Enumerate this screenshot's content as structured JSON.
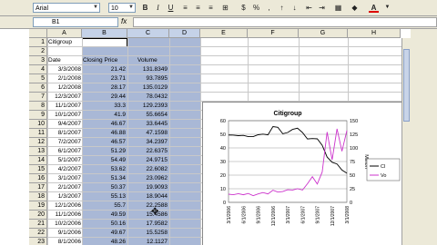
{
  "toolbar": {
    "font_name": "Arial",
    "font_size": "10",
    "bold_label": "B",
    "italic_label": "I",
    "underline_label": "U",
    "font_color_label": "A"
  },
  "formula_bar": {
    "name_box": "B1",
    "fx_label": "fx",
    "content": ""
  },
  "sheet": {
    "columns": [
      "A",
      "B",
      "C",
      "D",
      "E",
      "F",
      "G",
      "H"
    ],
    "rows": [
      {
        "n": "1",
        "a": "Citigroup",
        "b": "",
        "c": ""
      },
      {
        "n": "2",
        "a": "",
        "b": "",
        "c": ""
      },
      {
        "n": "3",
        "a": "Date",
        "b": "Closing Price",
        "c": "Volume"
      },
      {
        "n": "4",
        "a": "3/3/2008",
        "b": "21.42",
        "c": "131.8349"
      },
      {
        "n": "5",
        "a": "2/1/2008",
        "b": "23.71",
        "c": "93.7895"
      },
      {
        "n": "6",
        "a": "1/2/2008",
        "b": "28.17",
        "c": "135.0129"
      },
      {
        "n": "7",
        "a": "12/3/2007",
        "b": "29.44",
        "c": "78.0432"
      },
      {
        "n": "8",
        "a": "11/1/2007",
        "b": "33.3",
        "c": "129.2393"
      },
      {
        "n": "9",
        "a": "10/1/2007",
        "b": "41.9",
        "c": "55.6654"
      },
      {
        "n": "10",
        "a": "9/4/2007",
        "b": "46.67",
        "c": "33.6445"
      },
      {
        "n": "11",
        "a": "8/1/2007",
        "b": "46.88",
        "c": "47.1598"
      },
      {
        "n": "12",
        "a": "7/2/2007",
        "b": "46.57",
        "c": "34.2397"
      },
      {
        "n": "13",
        "a": "6/1/2007",
        "b": "51.29",
        "c": "22.6375"
      },
      {
        "n": "14",
        "a": "5/1/2007",
        "b": "54.49",
        "c": "24.9715"
      },
      {
        "n": "15",
        "a": "4/2/2007",
        "b": "53.62",
        "c": "22.6082"
      },
      {
        "n": "16",
        "a": "3/1/2007",
        "b": "51.34",
        "c": "23.0962"
      },
      {
        "n": "17",
        "a": "2/1/2007",
        "b": "50.37",
        "c": "19.9093"
      },
      {
        "n": "18",
        "a": "1/3/2007",
        "b": "55.13",
        "c": "18.9044"
      },
      {
        "n": "19",
        "a": "12/1/2006",
        "b": "55.7",
        "c": "22.2588"
      },
      {
        "n": "20",
        "a": "11/1/2006",
        "b": "49.59",
        "c": "15.4586"
      },
      {
        "n": "21",
        "a": "10/2/2006",
        "b": "50.16",
        "c": "17.9582"
      },
      {
        "n": "22",
        "a": "9/1/2006",
        "b": "49.67",
        "c": "15.5258"
      },
      {
        "n": "23",
        "a": "8/1/2006",
        "b": "48.26",
        "c": "12.1127"
      },
      {
        "n": "24",
        "a": "7/3/2006",
        "b": "48.31",
        "c": "16.39"
      }
    ]
  },
  "chart_data": {
    "type": "line",
    "title": "Citigroup",
    "x": [
      "3/1/2006",
      "4/1/2006",
      "5/1/2006",
      "6/1/2006",
      "7/1/2006",
      "8/1/2006",
      "9/1/2006",
      "10/1/2006",
      "11/1/2006",
      "12/1/2006",
      "1/1/2007",
      "2/1/2007",
      "3/1/2007",
      "4/1/2007",
      "5/1/2007",
      "6/1/2007",
      "7/1/2007",
      "8/1/2007",
      "9/1/2007",
      "10/1/2007",
      "11/1/2007",
      "12/1/2007",
      "1/1/2008",
      "2/1/2008",
      "3/1/2008"
    ],
    "xticks": [
      "3/1/2006",
      "6/1/2006",
      "9/1/2006",
      "12/1/2006",
      "3/1/2007",
      "6/1/2007",
      "9/1/2007",
      "12/1/2007",
      "3/1/2008"
    ],
    "series": [
      {
        "name": "Cl",
        "axis": "left",
        "color": "#000000",
        "values": [
          49.5,
          49.4,
          49.0,
          49.2,
          48.3,
          48.26,
          49.67,
          50.16,
          49.59,
          55.7,
          55.13,
          50.37,
          51.34,
          53.62,
          54.49,
          51.29,
          46.57,
          46.88,
          46.67,
          41.9,
          33.3,
          29.44,
          28.17,
          23.71,
          21.42
        ]
      },
      {
        "name": "Vo",
        "axis": "right",
        "color": "#cc33cc",
        "values": [
          15,
          14,
          16,
          14,
          16.39,
          12.11,
          15.53,
          17.96,
          15.46,
          22.26,
          18.9,
          19.91,
          23.1,
          22.61,
          24.97,
          22.64,
          34.24,
          47.16,
          33.64,
          55.67,
          129.24,
          78.04,
          135.01,
          93.79,
          131.83
        ]
      }
    ],
    "y_left": {
      "ylim": [
        0,
        60
      ],
      "ticks": [
        "0",
        "10",
        "20",
        "30",
        "40",
        "50",
        "60"
      ]
    },
    "y_right": {
      "ylim": [
        0,
        150
      ],
      "ticks": [
        "0",
        "25",
        "50",
        "75",
        "100",
        "125",
        "150"
      ],
      "label": "Million"
    },
    "grid": true,
    "legend": "right"
  }
}
